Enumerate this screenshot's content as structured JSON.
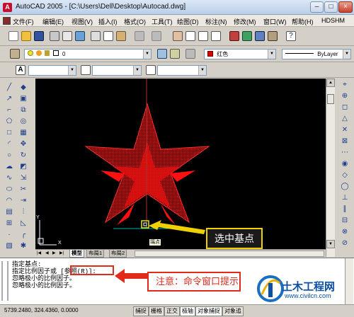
{
  "window": {
    "title": "AutoCAD 2005 - [C:\\Users\\Dell\\Desktop\\Autocad.dwg]",
    "app_icon_letter": "A"
  },
  "window_controls": {
    "minimize": "–",
    "maximize": "□",
    "close": "×"
  },
  "menu": [
    "文件(F)",
    "编辑(E)",
    "视图(V)",
    "插入(I)",
    "格式(O)",
    "工具(T)",
    "绘图(D)",
    "标注(N)",
    "修改(M)",
    "窗口(W)",
    "帮助(H)",
    "HDSHM"
  ],
  "layer_toolbar": {
    "layer_value": "0",
    "color_value": "红色",
    "linetype_value": "ByLayer"
  },
  "canvas": {
    "background": "#000000",
    "star_color": "#e01010",
    "cursor_color": "#00c0c0",
    "osnap_tooltip": "端点"
  },
  "ucs": {
    "x_label": "X",
    "y_label": "Y"
  },
  "layout_tabs": [
    "模型",
    "布局1",
    "布局2"
  ],
  "command_lines": [
    "指定基点:",
    "指定比例因子或 [参照(R)]:",
    "忽略极小的比例因子。",
    "忽略极小的比例因子。"
  ],
  "status": {
    "coords": "5739.2480,  324.4360,  0.0000",
    "toggles": [
      "捕捉",
      "栅格",
      "正交",
      "极轴",
      "对象捕捉",
      "对象追"
    ]
  },
  "annotations": {
    "select_base": "选中基点",
    "note": "注意：命令窗口提示"
  },
  "watermark": {
    "cn": "土木工程网",
    "url": "www.civilcn.com"
  }
}
